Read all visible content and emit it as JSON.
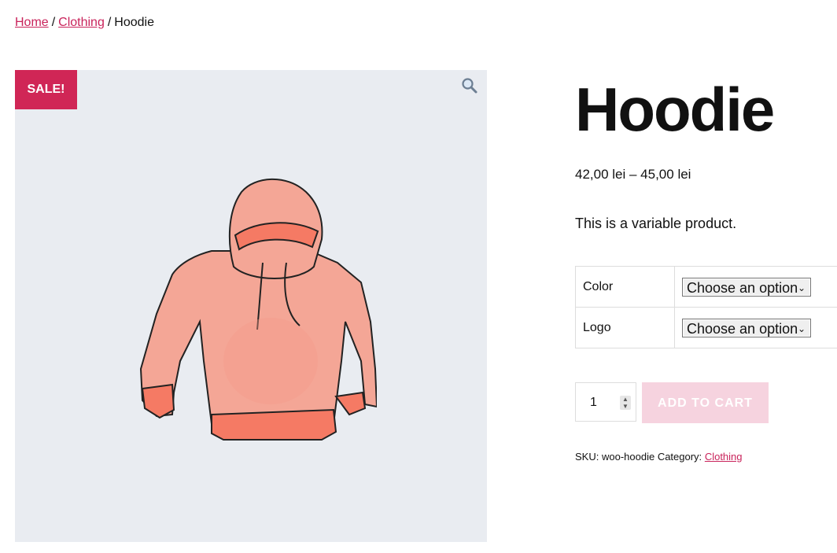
{
  "breadcrumb": {
    "home": "Home",
    "category": "Clothing",
    "separator": "/",
    "current": "Hoodie"
  },
  "gallery": {
    "sale_badge": "SALE!",
    "zoom_icon": "magnifier-icon",
    "image_subject": "pink-hoodie-illustration"
  },
  "product": {
    "title": "Hoodie",
    "price": "42,00 lei – 45,00 lei",
    "description": "This is a variable product.",
    "variations": [
      {
        "label": "Color",
        "selected": "Choose an option"
      },
      {
        "label": "Logo",
        "selected": "Choose an option"
      }
    ],
    "quantity": "1",
    "add_to_cart": "ADD TO CART",
    "sku_label": "SKU:",
    "sku": "woo-hoodie",
    "category_label": "Category:",
    "category": "Clothing"
  },
  "colors": {
    "accent": "#c9235b",
    "sale_badge": "#d02656",
    "button_disabled": "#f6d3df",
    "gallery_bg": "#e9ecf1"
  }
}
